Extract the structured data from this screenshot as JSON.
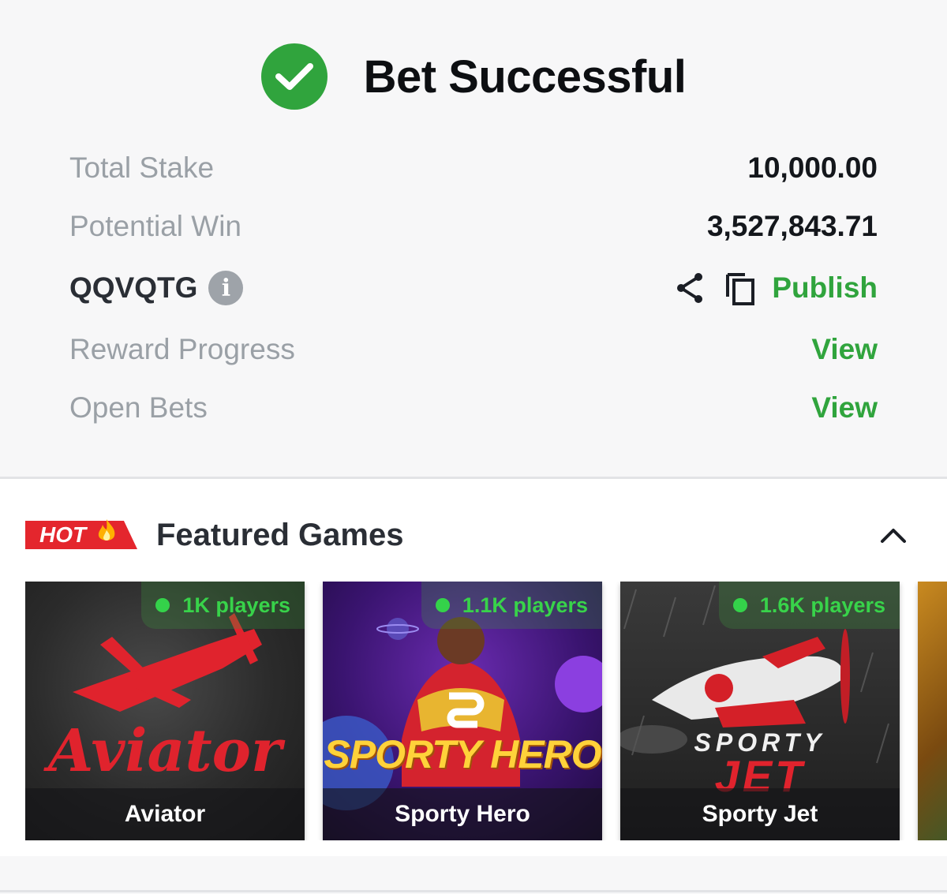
{
  "header": {
    "title": "Bet Successful"
  },
  "summary": {
    "total_stake_label": "Total Stake",
    "total_stake_value": "10,000.00",
    "potential_win_label": "Potential Win",
    "potential_win_value": "3,527,843.71",
    "booking_code": "QQVQTG",
    "info_glyph": "i",
    "publish_label": "Publish",
    "reward_progress_label": "Reward Progress",
    "reward_progress_link": "View",
    "open_bets_label": "Open Bets",
    "open_bets_link": "View"
  },
  "featured": {
    "hot_badge": "HOT",
    "title": "Featured Games",
    "games": [
      {
        "name": "Aviator",
        "players": "1K players",
        "logo": "Aviator"
      },
      {
        "name": "Sporty Hero",
        "players": "1.1K players",
        "logo": "SPORTY HERO"
      },
      {
        "name": "Sporty Jet",
        "players": "1.6K players",
        "logo_line1": "SPORTY",
        "logo_line2": "JET"
      }
    ]
  },
  "colors": {
    "accent_green": "#30a43d",
    "hot_red": "#e4262d",
    "text_gray": "#9aa0a6"
  },
  "icons": [
    "check-icon",
    "info-icon",
    "share-icon",
    "copy-icon",
    "chevron-up-icon",
    "flame-icon",
    "live-dot-icon"
  ]
}
